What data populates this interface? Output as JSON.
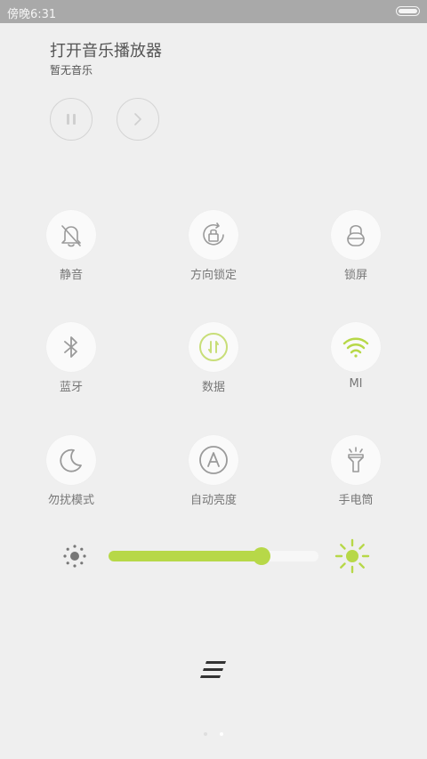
{
  "status_bar": {
    "time": "傍晚6:31"
  },
  "music": {
    "title": "打开音乐播放器",
    "subtitle": "暂无音乐",
    "controls": [
      {
        "name": "pause",
        "icon": "pause-icon"
      },
      {
        "name": "next",
        "icon": "chevron-right-icon"
      }
    ]
  },
  "toggles": [
    {
      "label": "静音",
      "icon": "bell-off-icon",
      "active": false
    },
    {
      "label": "方向锁定",
      "icon": "rotation-lock-icon",
      "active": false
    },
    {
      "label": "锁屏",
      "icon": "lock-icon",
      "active": false
    },
    {
      "label": "蓝牙",
      "icon": "bluetooth-icon",
      "active": false
    },
    {
      "label": "数据",
      "icon": "mobile-data-icon",
      "active": true
    },
    {
      "label": "MI",
      "icon": "wifi-icon",
      "active": true
    },
    {
      "label": "勿扰模式",
      "icon": "moon-icon",
      "active": false
    },
    {
      "label": "自动亮度",
      "icon": "auto-brightness-icon",
      "active": false
    },
    {
      "label": "手电筒",
      "icon": "flashlight-icon",
      "active": false
    }
  ],
  "brightness": {
    "level_percent": 73
  },
  "page_indicator": {
    "pages": 2,
    "current": 2
  },
  "colors": {
    "accent": "#b7d848",
    "icon_inactive": "#9a9a9a",
    "status_bar": "#a9a9a9"
  }
}
